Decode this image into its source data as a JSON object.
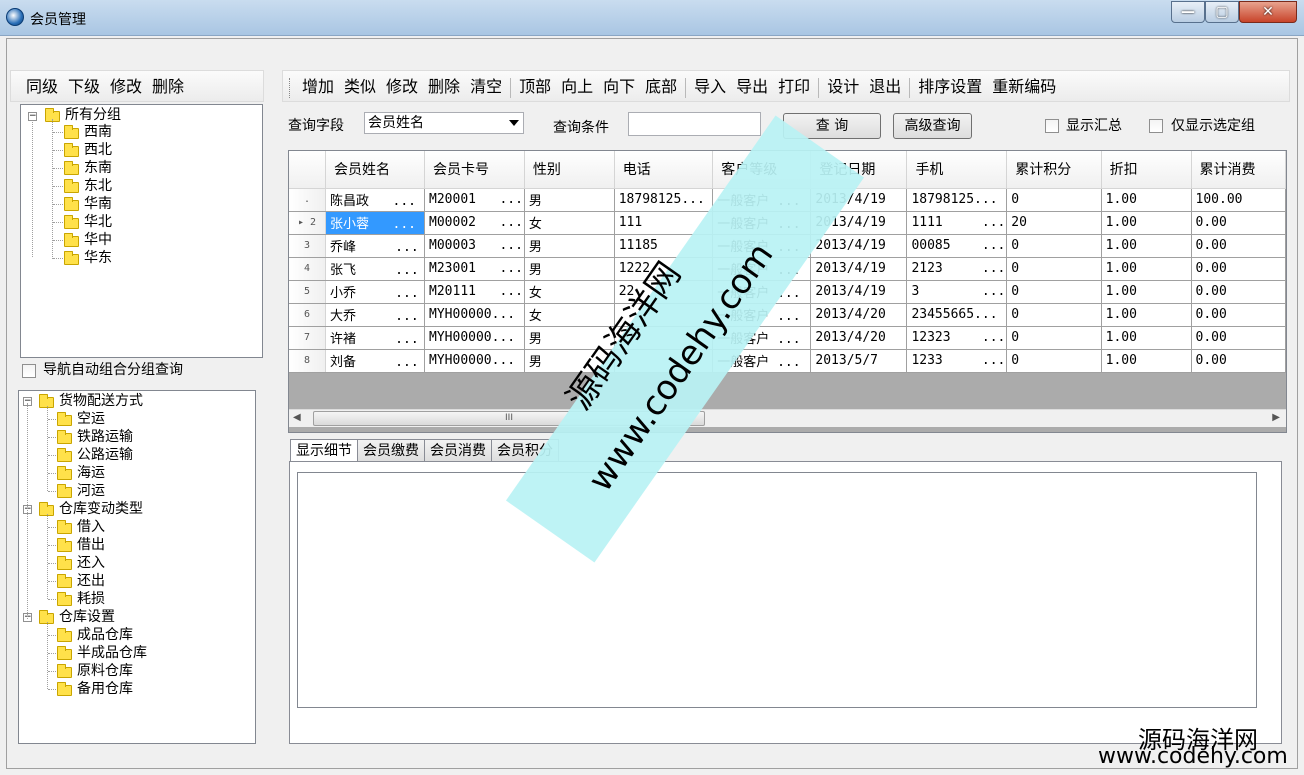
{
  "window": {
    "title": "会员管理"
  },
  "left_toolbar": {
    "items": [
      "同级",
      "下级",
      "修改",
      "删除"
    ]
  },
  "tree1": {
    "root": "所有分组",
    "children": [
      "西南",
      "西北",
      "东南",
      "东北",
      "华南",
      "华北",
      "华中",
      "华东"
    ]
  },
  "nav_auto_group": {
    "label": "导航自动组合分组查询",
    "checked": false
  },
  "tree2": {
    "groups": [
      {
        "label": "货物配送方式",
        "children": [
          "空运",
          "铁路运输",
          "公路运输",
          "海运",
          "河运"
        ]
      },
      {
        "label": "仓库变动类型",
        "children": [
          "借入",
          "借出",
          "还入",
          "还出",
          "耗损"
        ]
      },
      {
        "label": "仓库设置",
        "children": [
          "成品仓库",
          "半成品仓库",
          "原料仓库",
          "备用仓库"
        ]
      }
    ]
  },
  "main_toolbar": {
    "items": [
      "增加",
      "类似",
      "修改",
      "删除",
      "清空",
      "顶部",
      "向上",
      "向下",
      "底部",
      "导入",
      "导出",
      "打印",
      "设计",
      "退出",
      "排序设置",
      "重新编码"
    ]
  },
  "query": {
    "field_label": "查询字段",
    "field_value": "会员姓名",
    "condition_label": "查询条件",
    "condition_value": "",
    "search_button": "查  询",
    "advanced_button": "高级查询",
    "show_summary": "显示汇总",
    "show_selected_group": "仅显示选定组"
  },
  "grid": {
    "columns": [
      "会员姓名",
      "会员卡号",
      "性别",
      "电话",
      "客户等级",
      "登记日期",
      "手机",
      "累计积分",
      "折扣",
      "累计消费"
    ],
    "rows": [
      {
        "rh": ".",
        "cells": [
          "陈昌政   ...",
          "M20001   ...",
          "男",
          "18798125...",
          "一般客户 ...",
          "2013/4/19",
          "18798125...",
          "0",
          "1.00",
          "100.00"
        ]
      },
      {
        "rh": "▸ 2",
        "cells": [
          "张小蓉   ...",
          "M00002   ...",
          "女",
          "111",
          "一般客户 ...",
          "2013/4/19",
          "1111     ...",
          "20",
          "1.00",
          "0.00"
        ]
      },
      {
        "rh": "3",
        "cells": [
          "乔峰     ...",
          "M00003   ...",
          "男",
          "11185",
          "一般客户 ...",
          "2013/4/19",
          "00085    ...",
          "0",
          "1.00",
          "0.00"
        ]
      },
      {
        "rh": "4",
        "cells": [
          "张飞     ...",
          "M23001   ...",
          "男",
          "1222",
          "一般客户 ...",
          "2013/4/19",
          "2123     ...",
          "0",
          "1.00",
          "0.00"
        ]
      },
      {
        "rh": "5",
        "cells": [
          "小乔     ...",
          "M20111   ...",
          "女",
          "22",
          "一般客户 ...",
          "2013/4/19",
          "3        ...",
          "0",
          "1.00",
          "0.00"
        ]
      },
      {
        "rh": "6",
        "cells": [
          "大乔     ...",
          "MYH00000...",
          "女",
          "",
          "一般客户 ...",
          "2013/4/20",
          "23455665...",
          "0",
          "1.00",
          "0.00"
        ]
      },
      {
        "rh": "7",
        "cells": [
          "许褚     ...",
          "MYH00000...",
          "男",
          "",
          "一般客户 ...",
          "2013/4/20",
          "12323    ...",
          "0",
          "1.00",
          "0.00"
        ]
      },
      {
        "rh": "8",
        "cells": [
          "刘备     ...",
          "MYH00000...",
          "男",
          "",
          "一般客户 ...",
          "2013/5/7",
          "1233     ...",
          "0",
          "1.00",
          "0.00"
        ]
      }
    ],
    "selected_row": 1
  },
  "tabs": [
    "显示细节",
    "会员缴费",
    "会员消费",
    "会员积分"
  ],
  "active_tab": 0,
  "watermark": {
    "line1": "源码海洋网",
    "line2": "www.codehy.com"
  },
  "corner_logo": {
    "line1": "源码海洋网",
    "line2": "www.codehy.com"
  },
  "colors": {
    "selection": "#3399ff",
    "titlebar": "#b9d1ea",
    "watermark_band": "#b8f2f4"
  }
}
